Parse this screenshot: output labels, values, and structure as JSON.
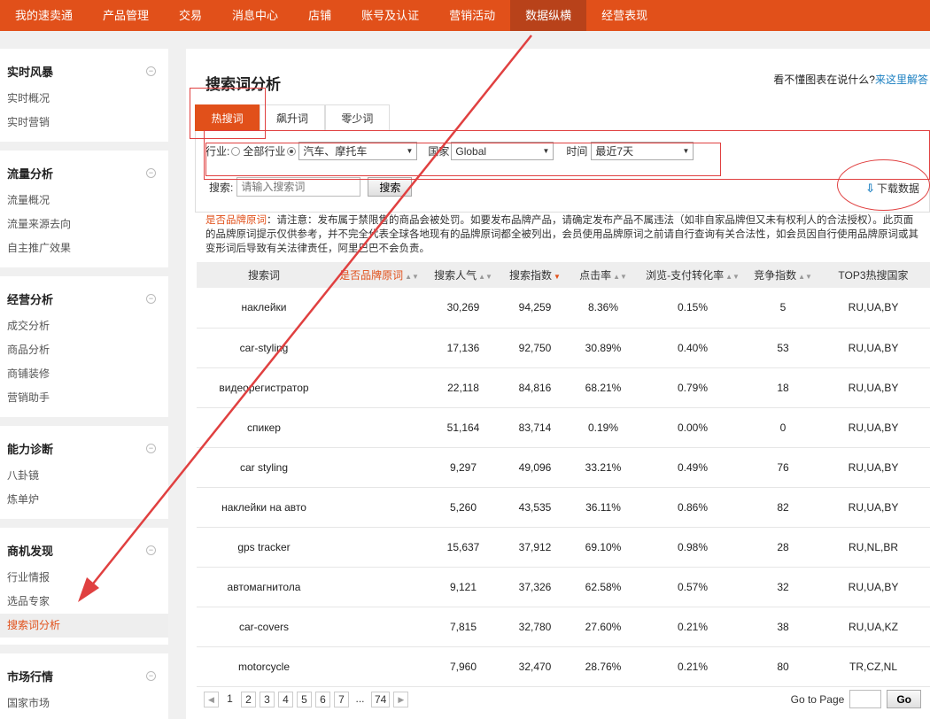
{
  "topnav": {
    "items": [
      "我的速卖通",
      "产品管理",
      "交易",
      "消息中心",
      "店铺",
      "账号及认证",
      "营销活动",
      "数据纵横",
      "经营表现"
    ],
    "active_index": 7
  },
  "sidebar": {
    "groups": [
      {
        "title": "实时风暴",
        "items": [
          "实时概况",
          "实时营销"
        ]
      },
      {
        "title": "流量分析",
        "items": [
          "流量概况",
          "流量来源去向",
          "自主推广效果"
        ]
      },
      {
        "title": "经营分析",
        "items": [
          "成交分析",
          "商品分析",
          "商铺装修",
          "营销助手"
        ]
      },
      {
        "title": "能力诊断",
        "items": [
          "八卦镜",
          "炼单炉"
        ]
      },
      {
        "title": "商机发现",
        "items": [
          "行业情报",
          "选品专家",
          "搜索词分析"
        ]
      },
      {
        "title": "市场行情",
        "items": [
          "国家市场"
        ]
      }
    ],
    "toggle_symbol": "−",
    "active_item": "搜索词分析"
  },
  "main": {
    "title": "搜索词分析",
    "help_text": "看不懂图表在说什么?",
    "help_link": "来这里解答",
    "tabs": [
      {
        "label": "热搜词",
        "active": true
      },
      {
        "label": "飙升词",
        "active": false
      },
      {
        "label": "零少词",
        "active": false
      }
    ],
    "filters": {
      "industry_label": "行业:",
      "all_industry": "全部行业",
      "industry_value": "汽车、摩托车",
      "country_label": "国家",
      "country_value": "Global",
      "time_label": "时间",
      "time_value": "最近7天",
      "search_label": "搜索:",
      "search_placeholder": "请输入搜索词",
      "search_button": "搜索"
    },
    "download_label": "下载数据",
    "notice_brand": "是否品牌原词",
    "notice_text": "：请注意：发布属于禁限售的商品会被处罚。如要发布品牌产品，请确定发布产品不属违法（如非自家品牌但又未有权利人的合法授权）。此页面的品牌原词提示仅供参考，并不完全代表全球各地现有的品牌原词都全被列出，会员使用品牌原词之前请自行查询有关合法性，如会员因自行使用品牌原词或其变形词后导致有关法律责任，阿里巴巴不会负责。"
  },
  "table": {
    "columns": [
      "搜索词",
      "是否品牌原词",
      "搜索人气",
      "搜索指数",
      "点击率",
      "浏览-支付转化率",
      "竞争指数",
      "TOP3热搜国家"
    ],
    "rows": [
      [
        "наклейки",
        "",
        "30,269",
        "94,259",
        "8.36%",
        "0.15%",
        "5",
        "RU,UA,BY"
      ],
      [
        "car-styling",
        "",
        "17,136",
        "92,750",
        "30.89%",
        "0.40%",
        "53",
        "RU,UA,BY"
      ],
      [
        "видеорегистратор",
        "",
        "22,118",
        "84,816",
        "68.21%",
        "0.79%",
        "18",
        "RU,UA,BY"
      ],
      [
        "спикер",
        "",
        "51,164",
        "83,714",
        "0.19%",
        "0.00%",
        "0",
        "RU,UA,BY"
      ],
      [
        "car styling",
        "",
        "9,297",
        "49,096",
        "33.21%",
        "0.49%",
        "76",
        "RU,UA,BY"
      ],
      [
        "наклейки на авто",
        "",
        "5,260",
        "43,535",
        "36.11%",
        "0.86%",
        "82",
        "RU,UA,BY"
      ],
      [
        "gps tracker",
        "",
        "15,637",
        "37,912",
        "69.10%",
        "0.98%",
        "28",
        "RU,NL,BR"
      ],
      [
        "автомагнитола",
        "",
        "9,121",
        "37,326",
        "62.58%",
        "0.57%",
        "32",
        "RU,UA,BY"
      ],
      [
        "car-covers",
        "",
        "7,815",
        "32,780",
        "27.60%",
        "0.21%",
        "38",
        "RU,UA,KZ"
      ],
      [
        "motorcycle",
        "",
        "7,960",
        "32,470",
        "28.76%",
        "0.21%",
        "80",
        "TR,CZ,NL"
      ]
    ]
  },
  "pagination": {
    "pages": [
      "1",
      "2",
      "3",
      "4",
      "5",
      "6",
      "7"
    ],
    "ellipsis": "...",
    "last_page": "74",
    "goto_label": "Go to Page",
    "goto_button": "Go"
  },
  "colors": {
    "accent": "#e1501a",
    "annotation_red": "#e04040",
    "link": "#1a7fc1"
  }
}
